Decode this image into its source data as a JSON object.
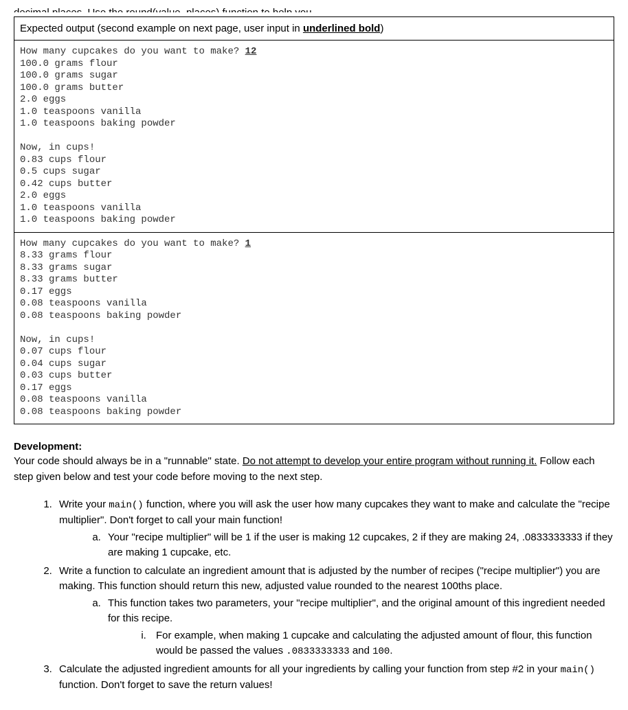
{
  "cutoff_fragment": "decimal places. Use the round(value, places) function to help you.",
  "header_box": {
    "prefix": "Expected output (second example on next page, user input in ",
    "emph": "underlined bold",
    "suffix": ")"
  },
  "example1": {
    "prompt": "How many cupcakes do you want to make? ",
    "user_input": "12",
    "grams_lines": "100.0 grams flour\n100.0 grams sugar\n100.0 grams butter\n2.0 eggs\n1.0 teaspoons vanilla\n1.0 teaspoons baking powder",
    "cups_header": "Now, in cups!",
    "cups_lines": "0.83 cups flour\n0.5 cups sugar\n0.42 cups butter\n2.0 eggs\n1.0 teaspoons vanilla\n1.0 teaspoons baking powder"
  },
  "example2": {
    "prompt": "How many cupcakes do you want to make? ",
    "user_input": "1",
    "grams_lines": "8.33 grams flour\n8.33 grams sugar\n8.33 grams butter\n0.17 eggs\n0.08 teaspoons vanilla\n0.08 teaspoons baking powder",
    "cups_header": "Now, in cups!",
    "cups_lines": "0.07 cups flour\n0.04 cups sugar\n0.03 cups butter\n0.17 eggs\n0.08 teaspoons vanilla\n0.08 teaspoons baking powder"
  },
  "development": {
    "heading": "Development:",
    "para_prefix": "Your code should always be in a \"runnable\" state. ",
    "para_underlined": "Do not attempt to develop your entire program without running it.",
    "para_suffix": " Follow each step given below and test your code before moving to the next step.",
    "steps": {
      "s1_a": "Write your ",
      "s1_code": "main()",
      "s1_b": " function, where you will ask the user how many cupcakes they want to make and calculate the \"recipe multiplier\". Don't forget to call your main function!",
      "s1a": "Your \"recipe multiplier\" will be 1 if the user is making 12 cupcakes, 2 if they are making 24, .0833333333 if they are making 1 cupcake, etc.",
      "s2": "Write a function to calculate an ingredient amount that is adjusted by the number of recipes (\"recipe multiplier\") you are making. This function should return this new, adjusted value rounded to the nearest 100ths place.",
      "s2a": "This function takes two parameters, your \"recipe multiplier\", and the original amount of this ingredient needed for this recipe.",
      "s2a_i_a": "For example, when making 1 cupcake and calculating the adjusted amount of flour, this function would be passed the values ",
      "s2a_i_code1": ".0833333333",
      "s2a_i_mid": " and ",
      "s2a_i_code2": "100",
      "s2a_i_suffix": ".",
      "s3_a": "Calculate the adjusted ingredient amounts for all your ingredients by calling your function from step #2 in your ",
      "s3_code": "main()",
      "s3_b": " function. Don't forget to save the return values!"
    }
  }
}
